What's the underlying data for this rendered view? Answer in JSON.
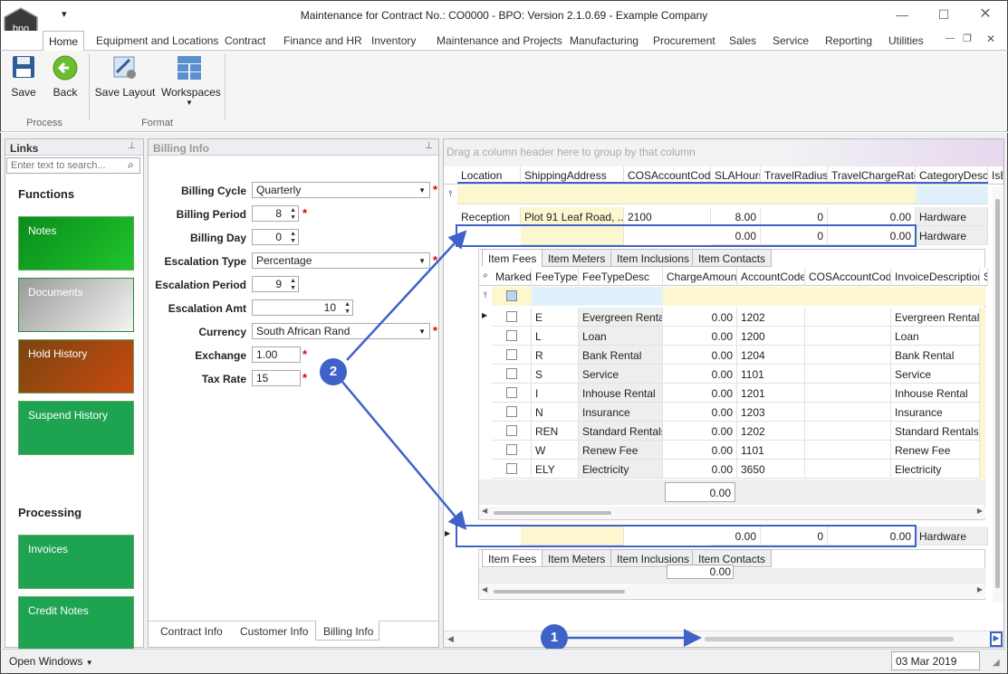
{
  "window": {
    "title": "Maintenance for Contract No.: CO0000    - BPO: Version 2.1.0.69 - Example Company",
    "logo_text": "bpo"
  },
  "ribbon_tabs": [
    "Home",
    "Equipment and Locations",
    "Contract",
    "Finance and HR",
    "Inventory",
    "Maintenance and Projects",
    "Manufacturing",
    "Procurement",
    "Sales",
    "Service",
    "Reporting",
    "Utilities"
  ],
  "ribbon": {
    "save": "Save",
    "back": "Back",
    "save_layout": "Save Layout",
    "workspaces": "Workspaces",
    "group_process": "Process",
    "group_format": "Format"
  },
  "links": {
    "title": "Links",
    "search_placeholder": "Enter text to search...",
    "functions_title": "Functions",
    "functions": [
      "Notes",
      "Documents",
      "Hold History",
      "Suspend History"
    ],
    "processing_title": "Processing",
    "processing": [
      "Invoices",
      "Credit Notes"
    ]
  },
  "billing": {
    "title": "Billing Info",
    "fields": {
      "cycle_label": "Billing Cycle",
      "cycle_value": "Quarterly",
      "period_label": "Billing Period",
      "period_value": "8",
      "day_label": "Billing Day",
      "day_value": "0",
      "esc_type_label": "Escalation Type",
      "esc_type_value": "Percentage",
      "esc_period_label": "Escalation Period",
      "esc_period_value": "9",
      "esc_amt_label": "Escalation Amt",
      "esc_amt_value": "10",
      "currency_label": "Currency",
      "currency_value": "South African Rand",
      "exchange_label": "Exchange",
      "exchange_value": "1.00",
      "tax_label": "Tax Rate",
      "tax_value": "15"
    },
    "tabs": [
      "Contract Info",
      "Customer Info",
      "Billing Info"
    ]
  },
  "grid": {
    "group_hint": "Drag a column header here to group by that column",
    "columns": [
      "Location",
      "ShippingAddress",
      "COSAccountCode",
      "SLAHours",
      "TravelRadius",
      "TravelChargeRate",
      "CategoryDesc",
      "IsE"
    ],
    "row1": {
      "location": "Reception",
      "address": "Plot 91 Leaf Road, ...",
      "cos": "2100",
      "sla": "8.00",
      "radius": "0",
      "rate": "0.00",
      "category": "Hardware"
    },
    "row2": {
      "sla": "0.00",
      "radius": "0",
      "rate": "0.00",
      "category": "Hardware"
    },
    "row3": {
      "sla": "0.00",
      "radius": "0",
      "rate": "0.00",
      "category": "Hardware"
    },
    "subtabs": [
      "Item Fees",
      "Item Meters",
      "Item Inclusions",
      "Item Contacts"
    ],
    "sub_columns": [
      "Marked",
      "FeeType",
      "FeeTypeDesc",
      "ChargeAmount",
      "AccountCode",
      "COSAccountCode",
      "InvoiceDescription",
      "S"
    ],
    "fees": [
      {
        "type": "E",
        "desc": "Evergreen Rental",
        "amount": "0.00",
        "account": "1202",
        "invoice": "Evergreen Rental"
      },
      {
        "type": "L",
        "desc": "Loan",
        "amount": "0.00",
        "account": "1200",
        "invoice": "Loan"
      },
      {
        "type": "R",
        "desc": "Bank Rental",
        "amount": "0.00",
        "account": "1204",
        "invoice": "Bank Rental"
      },
      {
        "type": "S",
        "desc": "Service",
        "amount": "0.00",
        "account": "1101",
        "invoice": "Service"
      },
      {
        "type": "I",
        "desc": "Inhouse Rental",
        "amount": "0.00",
        "account": "1201",
        "invoice": "Inhouse Rental"
      },
      {
        "type": "N",
        "desc": "Insurance",
        "amount": "0.00",
        "account": "1203",
        "invoice": "Insurance"
      },
      {
        "type": "REN",
        "desc": "Standard Rentals",
        "amount": "0.00",
        "account": "1202",
        "invoice": "Standard Rentals"
      },
      {
        "type": "W",
        "desc": "Renew Fee",
        "amount": "0.00",
        "account": "1101",
        "invoice": "Renew Fee"
      },
      {
        "type": "ELY",
        "desc": "Electricity",
        "amount": "0.00",
        "account": "3650",
        "invoice": "Electricity"
      }
    ],
    "fees_total": "0.00",
    "sub2_total": "0.00"
  },
  "callouts": {
    "one": "1",
    "two": "2"
  },
  "status": {
    "open_windows": "Open Windows",
    "date": "03 Mar 2019"
  }
}
